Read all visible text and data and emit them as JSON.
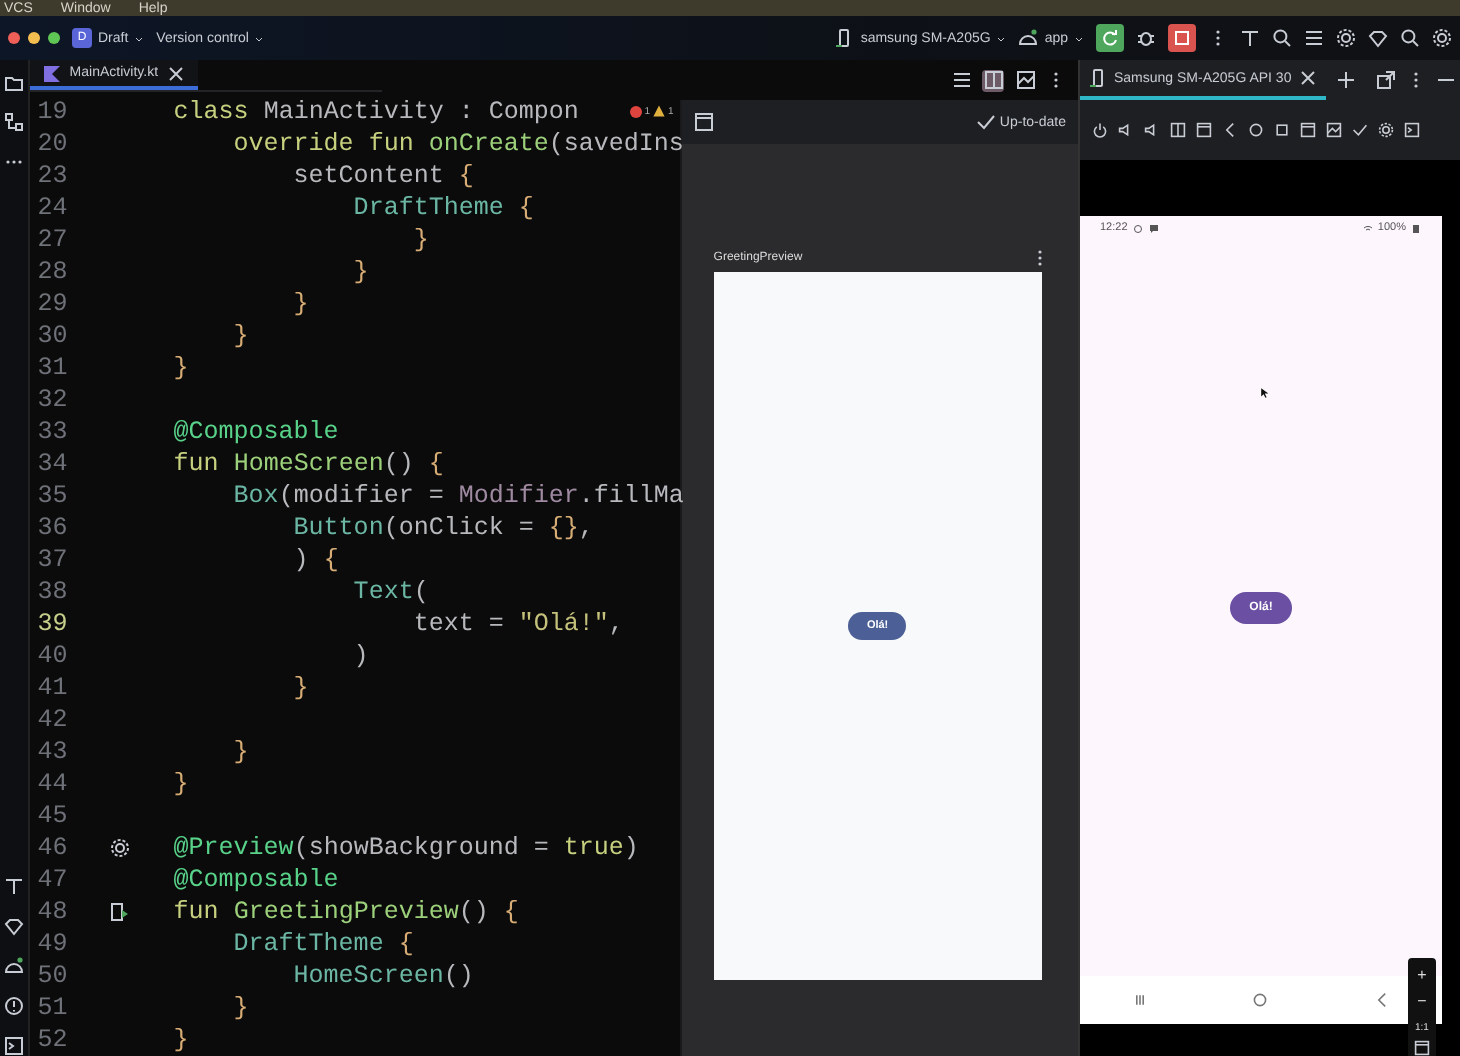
{
  "menu_bar": [
    "VCS",
    "Window",
    "Help"
  ],
  "title_bar": {
    "project": {
      "badge": "D",
      "name": "Draft"
    },
    "vcs": "Version control",
    "device": "samsung SM-A205G",
    "run_config": "app"
  },
  "editor": {
    "tab": {
      "label": "MainActivity.kt",
      "selected": true
    },
    "inspections": {
      "errors": "1",
      "warnings": "1"
    },
    "lines": [
      {
        "number": "19",
        "current": false,
        "segments": [
          {
            "text": "class ",
            "kind": "keyword"
          },
          {
            "text": "MainActivity : Compon",
            "kind": "plain"
          }
        ]
      },
      {
        "number": "20",
        "current": false,
        "segments": [
          {
            "text": "    override fun ",
            "kind": "keyword"
          },
          {
            "text": "onCreate",
            "kind": "function"
          },
          {
            "text": "(savedIns",
            "kind": "plain"
          }
        ]
      },
      {
        "number": "23",
        "current": false,
        "segments": [
          {
            "text": "        setContent ",
            "kind": "plain"
          },
          {
            "text": "{",
            "kind": "brace"
          }
        ]
      },
      {
        "number": "24",
        "current": false,
        "segments": [
          {
            "text": "            DraftTheme ",
            "kind": "type"
          },
          {
            "text": "{",
            "kind": "brace"
          }
        ]
      },
      {
        "number": "27",
        "current": false,
        "segments": [
          {
            "text": "                }",
            "kind": "brace"
          }
        ]
      },
      {
        "number": "28",
        "current": false,
        "segments": [
          {
            "text": "            }",
            "kind": "brace"
          }
        ]
      },
      {
        "number": "29",
        "current": false,
        "segments": [
          {
            "text": "        }",
            "kind": "brace"
          }
        ]
      },
      {
        "number": "30",
        "current": false,
        "segments": [
          {
            "text": "    }",
            "kind": "brace"
          }
        ]
      },
      {
        "number": "31",
        "current": false,
        "segments": [
          {
            "text": "}",
            "kind": "brace"
          }
        ]
      },
      {
        "number": "32",
        "current": false
      },
      {
        "number": "33",
        "current": false,
        "segments": [
          {
            "text": "@Composable",
            "kind": "annotation"
          }
        ]
      },
      {
        "number": "34",
        "current": false,
        "segments": [
          {
            "text": "fun ",
            "kind": "keyword"
          },
          {
            "text": "HomeScreen",
            "kind": "function"
          },
          {
            "text": "() ",
            "kind": "plain"
          },
          {
            "text": "{",
            "kind": "brace"
          }
        ]
      },
      {
        "number": "35",
        "current": false,
        "segments": [
          {
            "text": "    Box",
            "kind": "type"
          },
          {
            "text": "(modifier = ",
            "kind": "plain"
          },
          {
            "text": "Modifier",
            "kind": "object"
          },
          {
            "text": ".fillMa",
            "kind": "plain"
          }
        ]
      },
      {
        "number": "36",
        "current": false,
        "segments": [
          {
            "text": "        Button",
            "kind": "type"
          },
          {
            "text": "(onClick = ",
            "kind": "plain"
          },
          {
            "text": "{}",
            "kind": "brace"
          },
          {
            "text": ",",
            "kind": "plain"
          }
        ]
      },
      {
        "number": "37",
        "current": false,
        "segments": [
          {
            "text": "        ) ",
            "kind": "plain"
          },
          {
            "text": "{",
            "kind": "brace"
          }
        ]
      },
      {
        "number": "38",
        "current": false,
        "segments": [
          {
            "text": "            Text",
            "kind": "type"
          },
          {
            "text": "(",
            "kind": "plain"
          }
        ]
      },
      {
        "number": "39",
        "current": true,
        "segments": [
          {
            "text": "                text = ",
            "kind": "plain"
          },
          {
            "text": "\"Olá!\"",
            "kind": "string"
          },
          {
            "text": ",",
            "kind": "plain"
          }
        ]
      },
      {
        "number": "40",
        "current": false,
        "segments": [
          {
            "text": "            )",
            "kind": "plain"
          }
        ]
      },
      {
        "number": "41",
        "current": false,
        "segments": [
          {
            "text": "        }",
            "kind": "brace"
          }
        ]
      },
      {
        "number": "42",
        "current": false
      },
      {
        "number": "43",
        "current": false,
        "segments": [
          {
            "text": "    }",
            "kind": "brace"
          }
        ]
      },
      {
        "number": "44",
        "current": false,
        "segments": [
          {
            "text": "}",
            "kind": "brace"
          }
        ]
      },
      {
        "number": "45",
        "current": false
      },
      {
        "number": "46",
        "current": false,
        "kind": "settings",
        "segments": [
          {
            "text": "@Preview",
            "kind": "annotation"
          },
          {
            "text": "(showBackground = ",
            "kind": "plain"
          },
          {
            "text": "true",
            "kind": "keyword"
          },
          {
            "text": ")",
            "kind": "plain"
          }
        ]
      },
      {
        "number": "47",
        "current": false,
        "segments": [
          {
            "text": "@Composable",
            "kind": "annotation"
          }
        ]
      },
      {
        "number": "48",
        "current": false,
        "kind": "preview",
        "segments": [
          {
            "text": "fun ",
            "kind": "keyword"
          },
          {
            "text": "GreetingPreview",
            "kind": "function"
          },
          {
            "text": "() ",
            "kind": "plain"
          },
          {
            "text": "{",
            "kind": "brace"
          }
        ]
      },
      {
        "number": "49",
        "current": false,
        "segments": [
          {
            "text": "    DraftTheme ",
            "kind": "type"
          },
          {
            "text": "{",
            "kind": "brace"
          }
        ]
      },
      {
        "number": "50",
        "current": false,
        "segments": [
          {
            "text": "        HomeScreen",
            "kind": "type"
          },
          {
            "text": "()",
            "kind": "plain"
          }
        ]
      },
      {
        "number": "51",
        "current": false,
        "segments": [
          {
            "text": "    }",
            "kind": "brace"
          }
        ]
      },
      {
        "number": "52",
        "current": false,
        "segments": [
          {
            "text": "}",
            "kind": "brace"
          }
        ]
      }
    ]
  },
  "preview": {
    "status": "Up-to-date",
    "title": "GreetingPreview",
    "button": "Olá!"
  },
  "running_devices": {
    "tab": {
      "label": "Samsung SM-A205G API 30",
      "selected": true
    },
    "status_bar": {
      "time": "12:22",
      "battery": "100%"
    },
    "button": "Olá!",
    "zoom_controls": [
      "+",
      "−",
      "1:1"
    ]
  }
}
